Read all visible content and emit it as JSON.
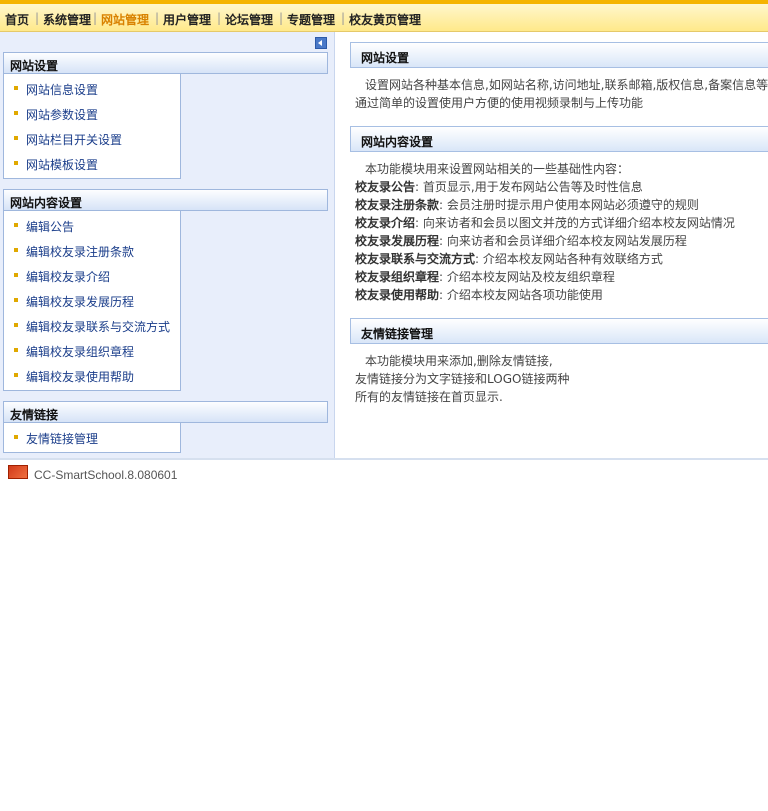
{
  "nav": {
    "items": [
      "首页",
      "系统管理",
      "网站管理",
      "用户管理",
      "论坛管理",
      "专题管理",
      "校友黄页管理"
    ],
    "active": "网站管理",
    "separator": "|"
  },
  "sidebar": {
    "collapse_icon": "collapse-left-icon",
    "panels": [
      {
        "title": "网站设置",
        "items": [
          "网站信息设置",
          "网站参数设置",
          "网站栏目开关设置",
          "网站模板设置"
        ]
      },
      {
        "title": "网站内容设置",
        "items": [
          "编辑公告",
          "编辑校友录注册条款",
          "编辑校友录介绍",
          "编辑校友录发展历程",
          "编辑校友录联系与交流方式",
          "编辑校友录组织章程",
          "编辑校友录使用帮助"
        ]
      },
      {
        "title": "友情链接",
        "items": [
          "友情链接管理"
        ]
      }
    ]
  },
  "content": {
    "sections": [
      {
        "title": "网站设置",
        "lines": [
          "设置网站各种基本信息,如网站名称,访问地址,联系邮箱,版权信息,备案信息等",
          "通过简单的设置使用户方便的使用视频录制与上传功能"
        ]
      },
      {
        "title": "网站内容设置",
        "intro": "本功能模块用来设置网站相关的一些基础性内容：",
        "defs": [
          {
            "term": "校友录公告",
            "desc": ": 首页显示,用于发布网站公告等及时性信息"
          },
          {
            "term": "校友录注册条款",
            "desc": ": 会员注册时提示用户使用本网站必须遵守的规则"
          },
          {
            "term": "校友录介绍",
            "desc": ": 向来访者和会员以图文并茂的方式详细介绍本校友网站情况"
          },
          {
            "term": "校友录发展历程",
            "desc": ": 向来访者和会员详细介绍本校友网站发展历程"
          },
          {
            "term": "校友录联系与交流方式",
            "desc": ": 介绍本校友网站各种有效联络方式"
          },
          {
            "term": "校友录组织章程",
            "desc": ": 介绍本校友网站及校友组织章程"
          },
          {
            "term": "校友录使用帮助",
            "desc": ": 介绍本校友网站各项功能使用"
          }
        ]
      },
      {
        "title": "友情链接管理",
        "lines": [
          "本功能模块用来添加,删除友情链接,",
          "友情链接分为文字链接和LOGO链接两种",
          "所有的友情链接在首页显示."
        ]
      }
    ]
  },
  "footer": {
    "logo_icon": "product-logo-icon",
    "version": "CC-SmartSchool.8.080601"
  },
  "colors": {
    "accent": "#f5b400",
    "active_nav": "#d98200",
    "link": "#1a3d8a",
    "sidebar_bg": "#e8eefb"
  }
}
